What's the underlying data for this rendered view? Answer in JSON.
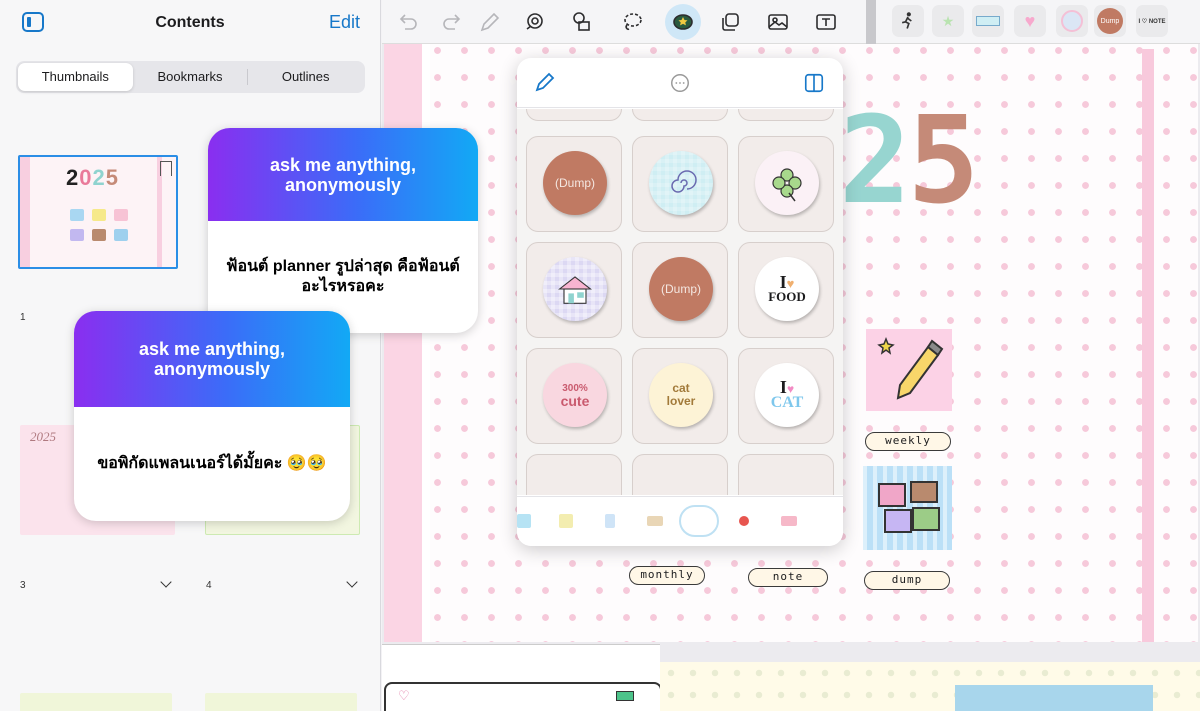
{
  "sidebar": {
    "title": "Contents",
    "edit_label": "Edit",
    "segments": [
      "Thumbnails",
      "Bookmarks",
      "Outlines"
    ],
    "active_segment": "Thumbnails",
    "thumb1_year": "2025",
    "thumb3_year": "2025",
    "page_numbers": [
      "1",
      "3",
      "4"
    ]
  },
  "cards": [
    {
      "header": "ask me anything, anonymously",
      "question": "ฟ้อนต์ planner รูปล่าสุด คือฟ้อนต์อะไรหรอคะ"
    },
    {
      "header": "ask me anything, anonymously",
      "question": "ขอพิกัดแพลนเนอร์ได้มั้ยคะ 🥹🥹"
    }
  ],
  "toolbar": {
    "icons": [
      "undo-icon",
      "redo-icon",
      "pencil-icon",
      "shape-icon",
      "elements-icon",
      "lasso-icon",
      "sticker-icon",
      "element-stack-icon",
      "image-icon",
      "text-icon"
    ],
    "active": "sticker-icon",
    "recent_stickers": [
      "runner",
      "star",
      "note-label",
      "heart",
      "checker-button",
      "Dump",
      "I NOTE"
    ],
    "recent_texts": {
      "dump": "Dump",
      "note": "I ♡ NOTE"
    }
  },
  "canvas": {
    "year_2": "2",
    "year_5": "5",
    "labels": {
      "weekly": "weekly",
      "monthly": "monthly",
      "note": "note",
      "dump": "dump"
    }
  },
  "popover": {
    "stickers": [
      {
        "label": "(Dump)",
        "style": "dump"
      },
      {
        "label": "",
        "style": "doodle"
      },
      {
        "label": "",
        "style": "clover"
      },
      {
        "label": "",
        "style": "house"
      },
      {
        "label": "(Dump)",
        "style": "dump"
      },
      {
        "label": "I ♡ FOOD",
        "style": "food",
        "i": "I",
        "word": "FOOD"
      },
      {
        "label": "300% cute",
        "style": "cute",
        "top": "300%",
        "word": "cute"
      },
      {
        "label": "cat lover",
        "style": "catlover",
        "top": "cat",
        "word": "lover"
      },
      {
        "label": "I ♡ CAT",
        "style": "cat",
        "i": "I",
        "word": "CAT"
      }
    ]
  },
  "colors": {
    "accent": "#1778c9",
    "ngl_gradient_start": "#8a2ef0",
    "ngl_gradient_end": "#12a9f5",
    "page_pink": "#fbd5e4",
    "dump_brown": "#c07a63"
  }
}
